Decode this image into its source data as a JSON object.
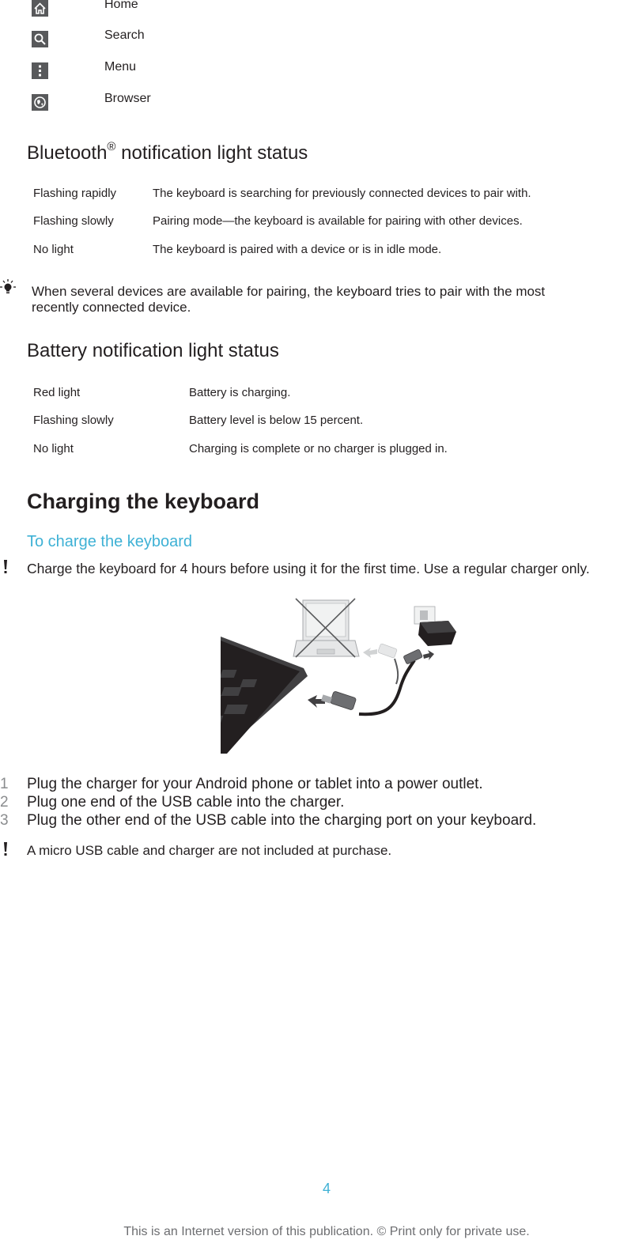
{
  "keys": [
    {
      "icon": "home-icon",
      "label": "Home"
    },
    {
      "icon": "search-icon",
      "label": "Search"
    },
    {
      "icon": "menu-icon",
      "label": "Menu"
    },
    {
      "icon": "browser-icon",
      "label": "Browser"
    }
  ],
  "bluetooth": {
    "title": "Bluetooth",
    "title_sup": "®",
    "title_rest": " notification light status",
    "rows": [
      {
        "state": "Flashing rapidly",
        "meaning": "The keyboard is searching for previously connected devices to pair with."
      },
      {
        "state": "Flashing slowly",
        "meaning": "Pairing mode—the keyboard is available for pairing with other devices."
      },
      {
        "state": "No light",
        "meaning": "The keyboard is paired with a device or is in idle mode."
      }
    ],
    "tip_line1": "When several devices are available for pairing, the keyboard tries to pair with the most",
    "tip_line2": "recently connected device."
  },
  "battery": {
    "title": "Battery notification light status",
    "rows": [
      {
        "state": "Red light",
        "meaning": "Battery is charging."
      },
      {
        "state": "Flashing slowly",
        "meaning": "Battery level is below 15 percent."
      },
      {
        "state": "No light",
        "meaning": "Charging is complete or no charger is plugged in."
      }
    ]
  },
  "charging": {
    "title": "Charging the keyboard",
    "subtitle": "To charge the keyboard",
    "warning": "Charge the keyboard for 4 hours before using it for the first time. Use a regular charger only.",
    "illustration": "keyboard-charging-illustration",
    "steps": [
      {
        "num": "1",
        "text": "Plug the charger for your Android phone or tablet into a power outlet."
      },
      {
        "num": "2",
        "text": "Plug one end of the USB cable into the charger."
      },
      {
        "num": "3",
        "text": "Plug the other end of the USB cable into the charging port on your keyboard."
      }
    ],
    "note": "A micro USB cable and charger are not included at purchase."
  },
  "footer": {
    "page_number": "4",
    "notice": "This is an Internet version of this publication. © Print only for private use."
  },
  "colors": {
    "accent": "#3eb1d5",
    "text": "#231f20",
    "icon_bg": "#58595b"
  }
}
